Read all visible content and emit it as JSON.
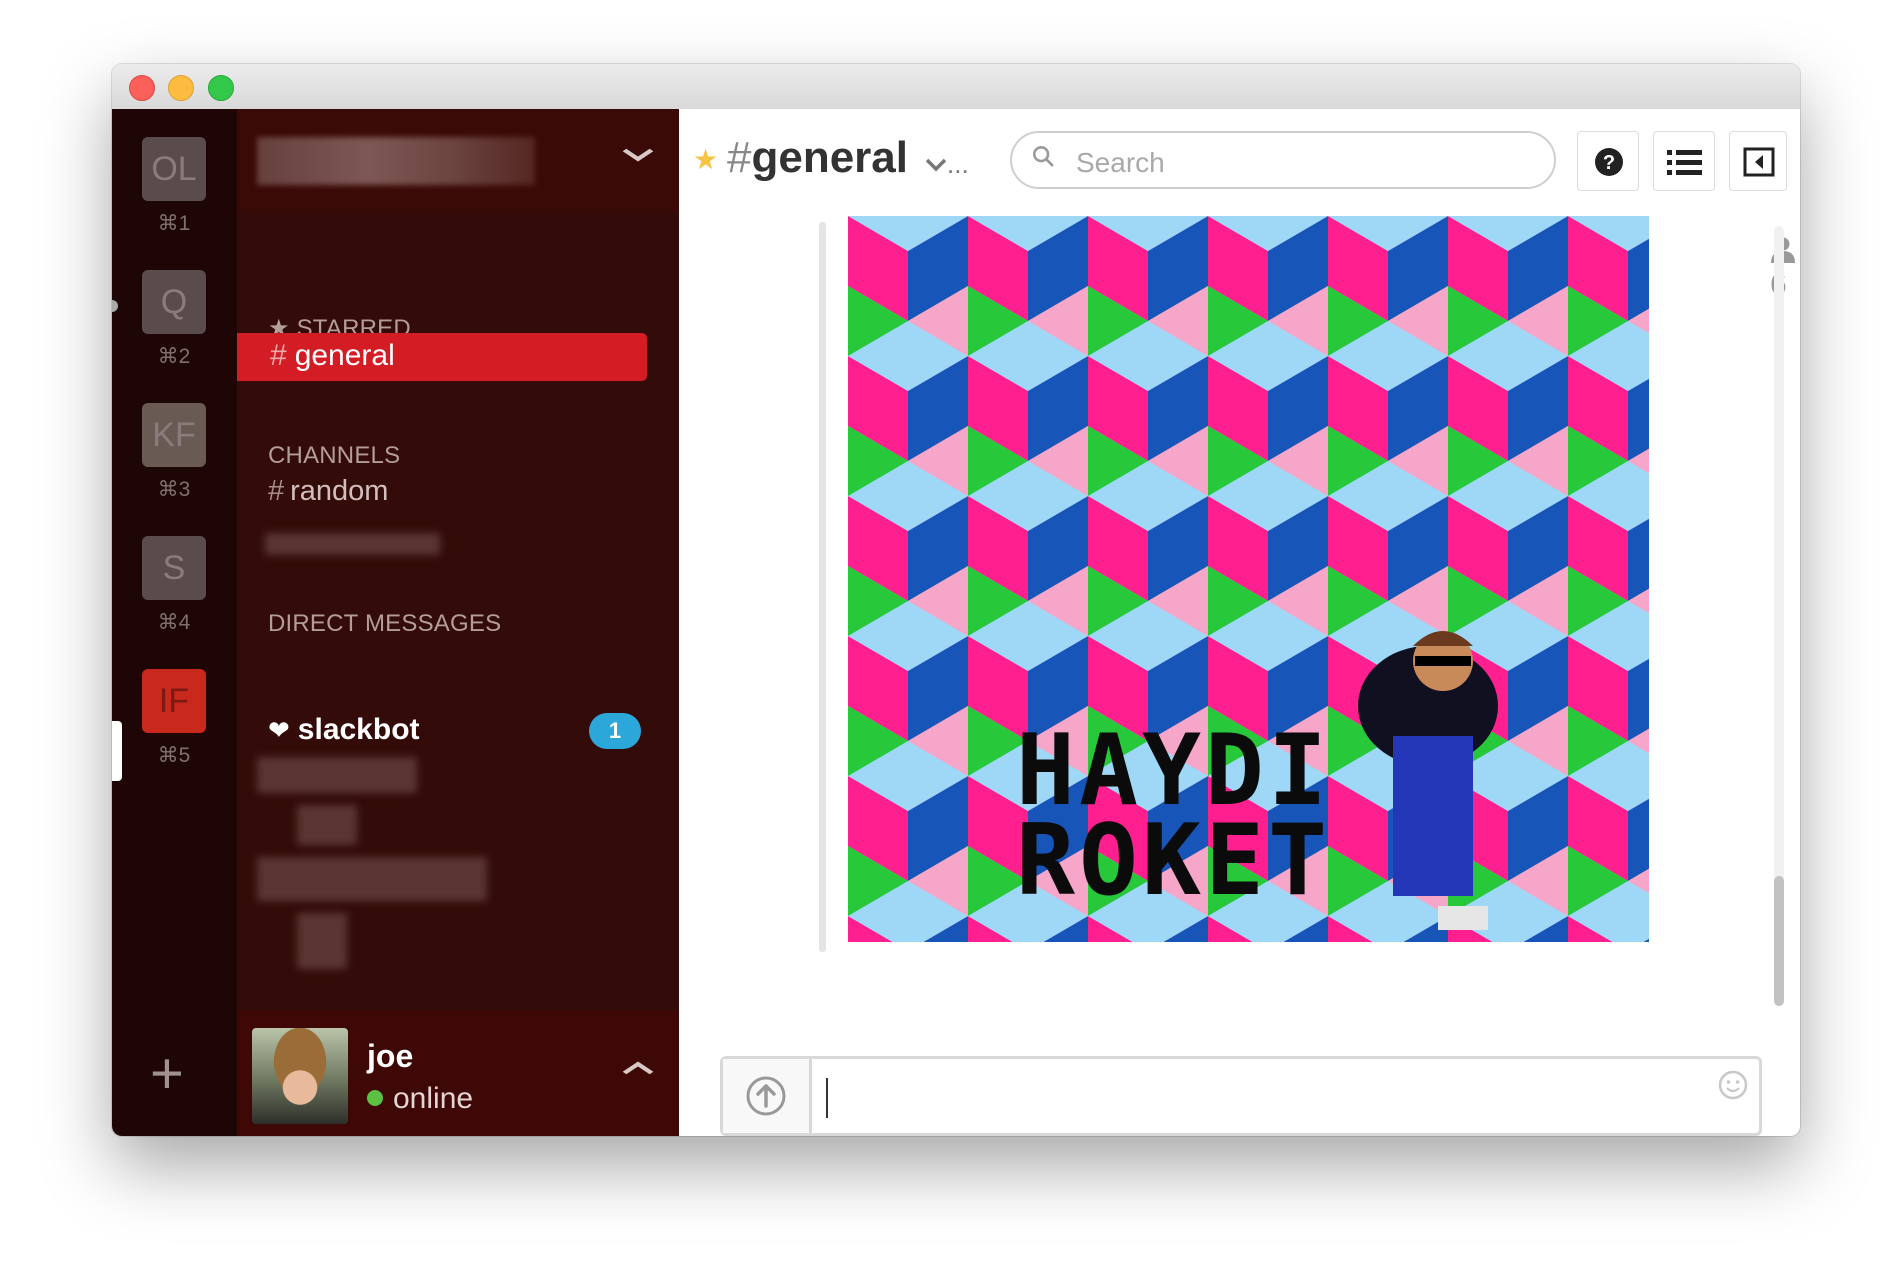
{
  "teams": [
    {
      "initials": "OL",
      "shortcut": "⌘1"
    },
    {
      "initials": "Q",
      "shortcut": "⌘2"
    },
    {
      "initials": "KF",
      "shortcut": "⌘3"
    },
    {
      "initials": "S",
      "shortcut": "⌘4"
    },
    {
      "initials": "IF",
      "shortcut": "⌘5",
      "active": true
    }
  ],
  "add_team_label": "+",
  "sidebar": {
    "starred_title": "STARRED",
    "starred_channel": "general",
    "channels_title": "CHANNELS",
    "channel_random": "random",
    "dm_title": "DIRECT MESSAGES",
    "dm_slackbot": "slackbot",
    "dm_badge": "1",
    "hash": "#"
  },
  "user": {
    "name": "joe",
    "status": "online"
  },
  "header": {
    "hash": "#",
    "channel": "general",
    "ellipsis": "...",
    "search_placeholder": "Search",
    "member_count": "6"
  },
  "image_text": {
    "line1": "HAYDI",
    "line2": "ROKET"
  },
  "colors": {
    "sidebar_bg": "#330c09",
    "active_channel": "#d31c24",
    "badge": "#2ba8d9",
    "online": "#5cc143",
    "star": "#f6c343"
  }
}
